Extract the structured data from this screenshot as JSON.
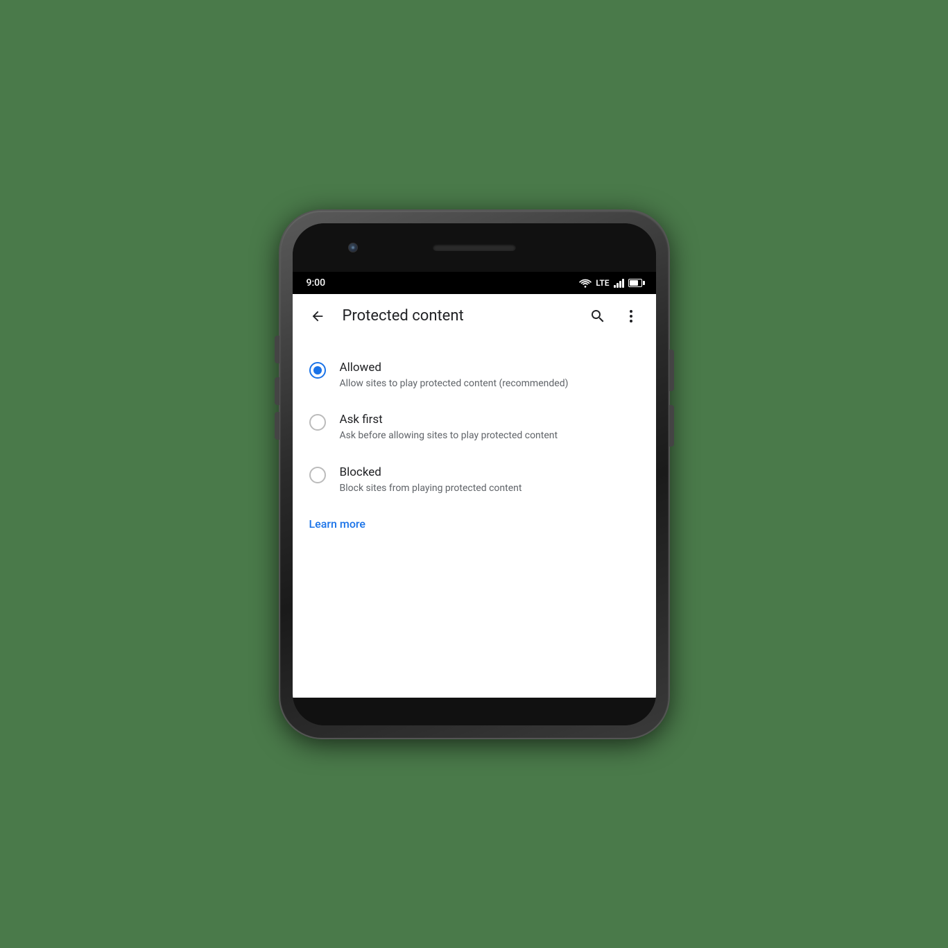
{
  "statusBar": {
    "time": "9:00",
    "lte": "LTE"
  },
  "appBar": {
    "title": "Protected content",
    "backLabel": "back",
    "searchLabel": "search",
    "moreLabel": "more options"
  },
  "options": [
    {
      "id": "allowed",
      "title": "Allowed",
      "description": "Allow sites to play protected content (recommended)",
      "selected": true
    },
    {
      "id": "ask-first",
      "title": "Ask first",
      "description": "Ask before allowing sites to play protected content",
      "selected": false
    },
    {
      "id": "blocked",
      "title": "Blocked",
      "description": "Block sites from playing protected content",
      "selected": false
    }
  ],
  "learnMore": {
    "label": "Learn more"
  }
}
